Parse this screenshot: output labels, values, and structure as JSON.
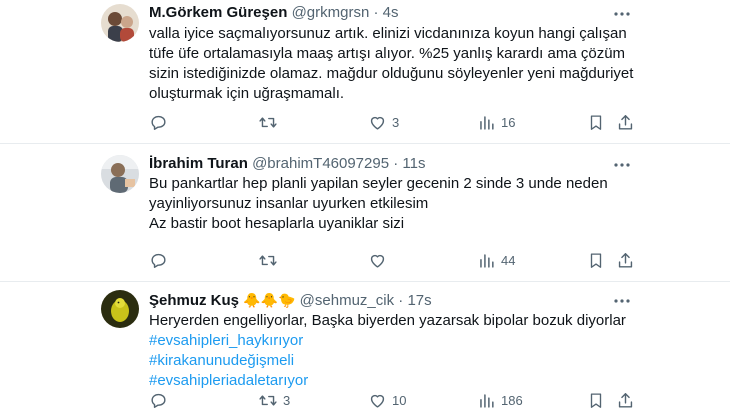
{
  "tweets": [
    {
      "name": "M.Görkem Güreşen",
      "name_emoji": "",
      "handle": "@grkmgrsn",
      "separator": "·",
      "time": "4s",
      "text_lines": [
        "valla iyice saçmalıyorsunuz artık. elinizi vicdanınıza koyun hangi çalışan",
        "tüfe üfe ortalamasıyla maaş artışı alıyor. %25 yanlış karardı ama çözüm",
        "sizin istediğinizde olamaz. mağdur olduğunu söyleyenler yeni mağduriyet",
        "oluşturmak için uğraşmamalı."
      ],
      "hashtags": [],
      "replies": "",
      "retweets": "",
      "likes": "3",
      "views": "16",
      "avatar_colors": [
        "#d7c6b0",
        "#6b4a37"
      ]
    },
    {
      "name": "İbrahim Turan",
      "name_emoji": "",
      "handle": "@brahimT46097295",
      "separator": "·",
      "time": "11s",
      "text_lines": [
        "Bu pankartlar hep planli yapilan seyler gecenin 2 sinde 3 unde neden",
        "yayinliyorsunuz insanlar uyurken etkilesim",
        "Az bastir boot hesaplarla uyaniklar sizi"
      ],
      "hashtags": [],
      "replies": "",
      "retweets": "",
      "likes": "",
      "views": "44",
      "avatar_colors": [
        "#c9d0d6",
        "#8a7b6a"
      ]
    },
    {
      "name": "Şehmuz Kuş",
      "name_emoji": "🐥🐥🐤",
      "handle": "@sehmuz_cik",
      "separator": "·",
      "time": "17s",
      "text_lines": [
        "Heryerden engelliyorlar, Başka biyerden yazarsak bipolar bozuk diyorlar"
      ],
      "hashtags": [
        "#evsahipleri_haykırıyor",
        "#kirakanunudeğişmeli",
        "#evsahipleriadaletarıyor"
      ],
      "replies": "",
      "retweets": "3",
      "likes": "10",
      "views": "186",
      "avatar_colors": [
        "#2b2d10",
        "#c9c21a"
      ]
    }
  ],
  "colors": {
    "text": "#0f1419",
    "secondary": "#536471",
    "hashtag": "#1d9bf0",
    "divider": "#e8ecef"
  },
  "icons": [
    "more-icon",
    "reply-icon",
    "retweet-icon",
    "like-icon",
    "views-icon",
    "bookmark-icon",
    "share-icon"
  ]
}
